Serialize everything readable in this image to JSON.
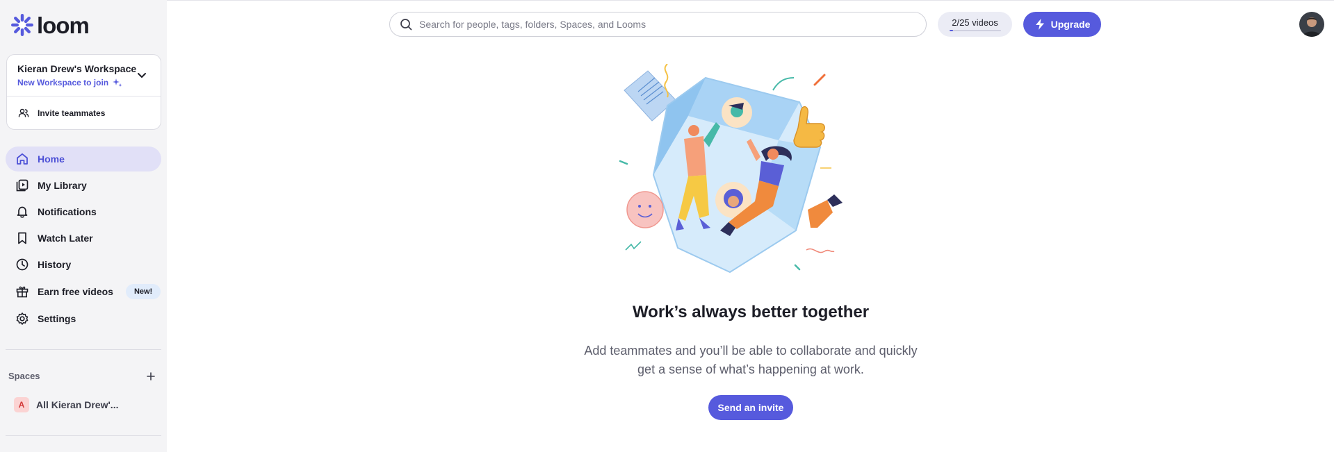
{
  "app": {
    "logo_text": "loom"
  },
  "workspace": {
    "name": "Kieran Drew's Workspace",
    "join_link": "New Workspace to join",
    "invite_label": "Invite teammates"
  },
  "nav": {
    "items": [
      {
        "label": "Home",
        "icon": "home-icon",
        "active": true
      },
      {
        "label": "My Library",
        "icon": "library-icon"
      },
      {
        "label": "Notifications",
        "icon": "bell-icon"
      },
      {
        "label": "Watch Later",
        "icon": "bookmark-icon"
      },
      {
        "label": "History",
        "icon": "clock-icon"
      },
      {
        "label": "Earn free videos",
        "icon": "gift-icon",
        "badge": "New!"
      },
      {
        "label": "Settings",
        "icon": "gear-icon"
      }
    ]
  },
  "spaces": {
    "heading": "Spaces",
    "items": [
      {
        "avatar_letter": "A",
        "label": "All Kieran Drew'..."
      }
    ]
  },
  "topbar": {
    "search_placeholder": "Search for people, tags, folders, Spaces, and Looms",
    "quota_label": "2/25 videos",
    "quota_used": 2,
    "quota_total": 25,
    "upgrade_label": "Upgrade"
  },
  "empty_state": {
    "headline": "Work’s always better together",
    "description_line1": "Add teammates and you’ll be able to collaborate and quickly",
    "description_line2": "get a sense of what’s happening at work.",
    "cta_label": "Send an invite"
  },
  "colors": {
    "accent": "#565add",
    "sidebar_bg": "#f4f4f6",
    "active_bg": "#e1e0f7"
  }
}
